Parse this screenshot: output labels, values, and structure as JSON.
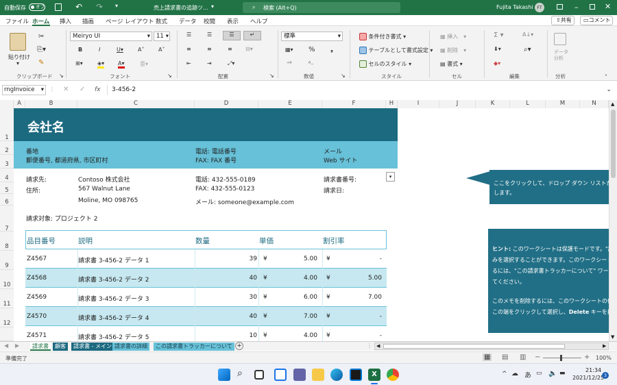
{
  "titlebar": {
    "autosave_label": "自動保存",
    "autosave_state": "オフ",
    "doc_title": "売上請求書の追跡ツ...",
    "search_placeholder": "検索 (Alt+Q)",
    "user_name": "Fujita Takashi",
    "user_initials": "FT"
  },
  "menu": {
    "items": [
      "ファイル",
      "ホーム",
      "挿入",
      "描画",
      "ページ レイアウト",
      "数式",
      "データ",
      "校閲",
      "表示",
      "ヘルプ"
    ],
    "active": "ホーム",
    "share_label": "共有",
    "comment_label": "コメント"
  },
  "ribbon": {
    "paste_label": "貼り付け",
    "clipboard_group": "クリップボード",
    "font_name": "Meiryo UI",
    "font_size": "11",
    "font_group": "フォント",
    "align_group": "配置",
    "number_format": "標準",
    "number_group": "数値",
    "cond_format": "条件付き書式",
    "table_format": "テーブルとして書式設定",
    "cell_styles": "セルのスタイル",
    "style_group": "スタイル",
    "insert_label": "挿入",
    "delete_label": "削除",
    "format_label": "書式",
    "cells_group": "セル",
    "edit_group": "編集",
    "analyze_label": "データ分析",
    "analyze_group": "分析"
  },
  "formula": {
    "name_box": "rngInvoice",
    "fx": "fx",
    "value": "3-456-2"
  },
  "columns": [
    "A",
    "B",
    "C",
    "D",
    "E",
    "F",
    "H",
    "I",
    "J",
    "K",
    "L",
    "M",
    "N"
  ],
  "rows": [
    "1",
    "2",
    "3",
    "4",
    "5",
    "6",
    "7",
    "8",
    "9",
    "10",
    "11",
    "12"
  ],
  "invoice": {
    "company": "会社名",
    "street": "番地",
    "address": "郵便番号, 都道府県, 市区町村",
    "phone_label": "電話: 電話番号",
    "fax_label": "FAX: FAX 番号",
    "email_label": "メール",
    "web_label": "Web サイト",
    "billto_label": "請求先:",
    "billto_name": "Contoso 株式会社",
    "address_label": "住所:",
    "billto_street": "567 Walnut Lane",
    "billto_city": "Moline, MO 098765",
    "cust_phone": "電話: 432-555-0189",
    "cust_fax": "FAX: 432-555-0123",
    "cust_email": "メール: someone@example.com",
    "invoice_no_label": "請求書番号:",
    "invoice_date_label": "請求日:",
    "project": "請求対象: プロジェクト 2"
  },
  "table": {
    "headers": [
      "品目番号",
      "説明",
      "数量",
      "単価",
      "割引率"
    ],
    "rows": [
      {
        "id": "Z4567",
        "desc": "請求書 3-456-2 データ 1",
        "qty": "39",
        "cur": "¥",
        "price": "5.00",
        "dcur": "¥",
        "disc": "-"
      },
      {
        "id": "Z4568",
        "desc": "請求書 3-456-2 データ 2",
        "qty": "40",
        "cur": "¥",
        "price": "4.00",
        "dcur": "¥",
        "disc": "5.00"
      },
      {
        "id": "Z4569",
        "desc": "請求書 3-456-2 データ 3",
        "qty": "30",
        "cur": "¥",
        "price": "6.00",
        "dcur": "¥",
        "disc": "7.00"
      },
      {
        "id": "Z4570",
        "desc": "請求書 3-456-2 データ 4",
        "qty": "40",
        "cur": "¥",
        "price": "7.00",
        "dcur": "¥",
        "disc": "-"
      },
      {
        "id": "Z4571",
        "desc": "請求書 3-456-2 データ 5",
        "qty": "10",
        "cur": "¥",
        "price": "4.00",
        "dcur": "¥",
        "disc": "-"
      }
    ]
  },
  "callout1": {
    "text1": "ここをクリックして、ドロップ ダウン リストから請求",
    "text2": "します。"
  },
  "callout2": {
    "hint_label": "ヒント:",
    "line1": " このワークシートは保護モードです。\"請求",
    "line2": "みを選択することができます。このワークシートの",
    "line3": "るには、\"この請求書トラッカーについて\" ワークシ",
    "line4": "てください。",
    "line5": "このメモを削除するには、このワークシートの保護",
    "line6": "この端をクリックして選択し、",
    "delete_word": "Delete",
    "line6b": " キーを押し"
  },
  "sheets": [
    {
      "label": "請求書",
      "active": true
    },
    {
      "label": "顧客"
    },
    {
      "label": "請求書 - メイン"
    },
    {
      "label": "請求書の詳細"
    },
    {
      "label": "この請求書トラッカーについて"
    }
  ],
  "status": {
    "ready": "準備完了",
    "zoom": "100%"
  },
  "clock": {
    "time": "21:34",
    "date": "2021/12/25",
    "badge": "3",
    "ime": "あ"
  },
  "colors": {
    "brand": "#217346",
    "header_dark": "#1c6a80",
    "header_light": "#67c1d8",
    "row_alt": "#c7e8f0",
    "callout": "#216f86"
  }
}
